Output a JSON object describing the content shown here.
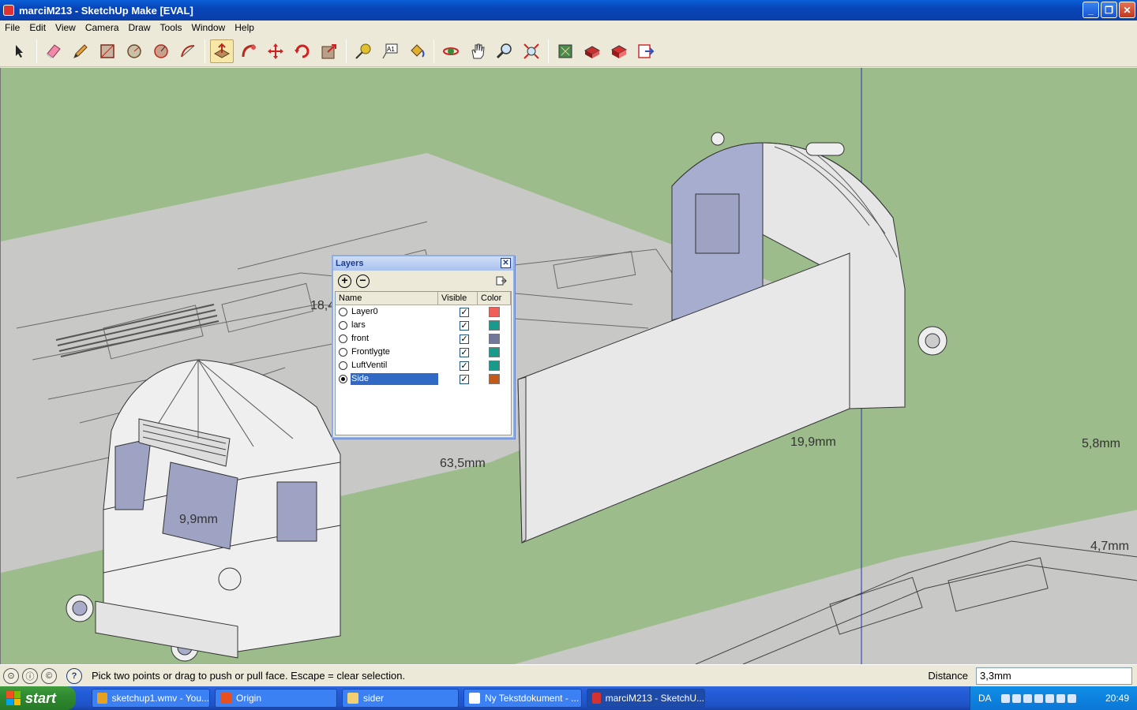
{
  "window": {
    "title": "marciM213 - SketchUp Make [EVAL]",
    "buttons": [
      "minimize",
      "restore",
      "close"
    ]
  },
  "menu": [
    "File",
    "Edit",
    "View",
    "Camera",
    "Draw",
    "Tools",
    "Window",
    "Help"
  ],
  "toolbar": {
    "groups": [
      [
        "select-icon"
      ],
      [
        "eraser-icon",
        "pencil-icon",
        "rectangle-icon",
        "circle-icon",
        "polygon-icon",
        "arc-icon"
      ],
      [
        "push-pull-icon",
        "follow-me-icon",
        "move-icon",
        "rotate-icon",
        "scale-icon"
      ],
      [
        "tape-measure-icon",
        "text-icon",
        "paint-bucket-icon"
      ],
      [
        "orbit-icon",
        "pan-icon",
        "zoom-icon",
        "zoom-extents-icon"
      ],
      [
        "get-models-icon",
        "share-model-icon",
        "components-icon",
        "send-to-layout-icon"
      ]
    ],
    "active_tool": "push-pull-icon"
  },
  "viewport": {
    "background": "#9cbd8b",
    "dimensions": [
      "18,4",
      "63,5mm",
      "19,9mm",
      "9,9mm",
      "5,8mm",
      "4,7mm"
    ]
  },
  "layers_dialog": {
    "title": "Layers",
    "columns": {
      "name": "Name",
      "visible": "Visible",
      "color": "Color"
    },
    "rows": [
      {
        "name": "Layer0",
        "visible": true,
        "color": "#f0605a",
        "active": false
      },
      {
        "name": "lars",
        "visible": true,
        "color": "#1a9a8a",
        "active": false
      },
      {
        "name": "front",
        "visible": true,
        "color": "#72789a",
        "active": false
      },
      {
        "name": "Frontlygte",
        "visible": true,
        "color": "#1a9a8a",
        "active": false
      },
      {
        "name": "LuftVentil",
        "visible": true,
        "color": "#1a9a8a",
        "active": false
      },
      {
        "name": "Side",
        "visible": true,
        "color": "#c45a1a",
        "active": true
      }
    ]
  },
  "status": {
    "message": "Pick two points or drag to push or pull face.  Escape = clear selection.",
    "measurement_label": "Distance",
    "measurement_value": "3,3mm"
  },
  "taskbar": {
    "start_label": "start",
    "tasks": [
      {
        "label": "sketchup1.wmv - You...",
        "icon_color": "#e8a020",
        "active": false
      },
      {
        "label": "Origin",
        "icon_color": "#e85020",
        "active": false
      },
      {
        "label": "sider",
        "icon_color": "#f0d070",
        "active": false
      },
      {
        "label": "Ny Tekstdokument - ...",
        "icon_color": "#ffffff",
        "active": false
      },
      {
        "label": "marciM213 - SketchU...",
        "icon_color": "#d33333",
        "active": true
      }
    ],
    "language": "DA",
    "clock": "20:49"
  }
}
